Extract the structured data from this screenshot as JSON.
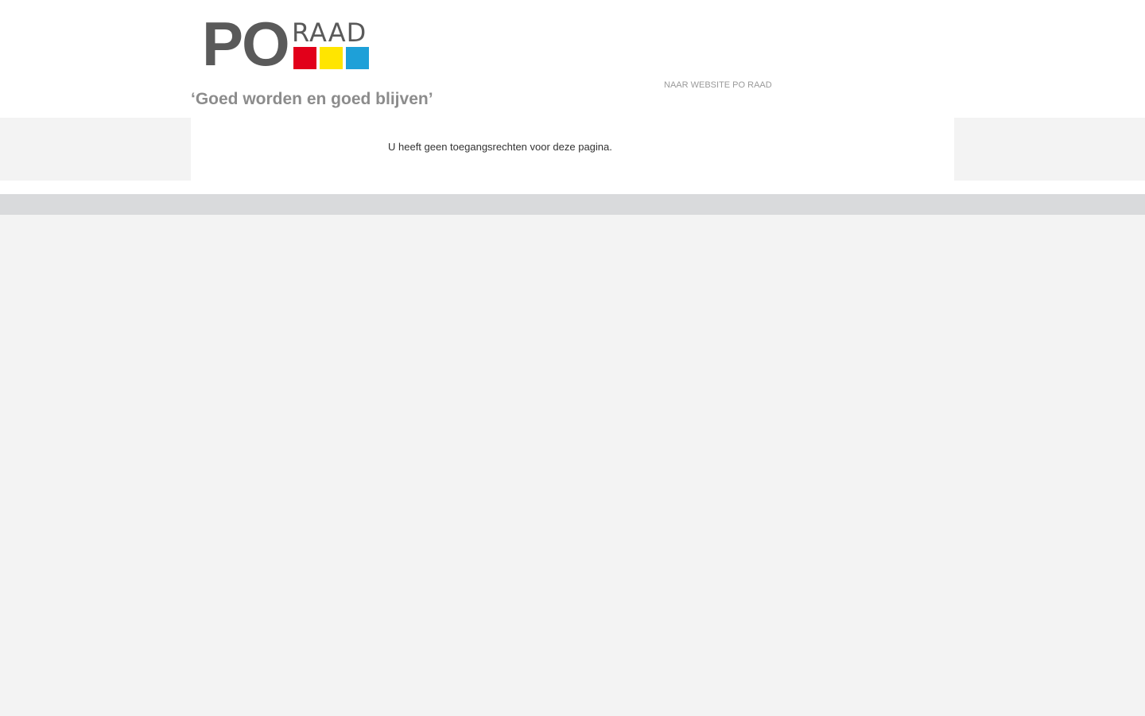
{
  "header": {
    "logo": {
      "po_text": "PO",
      "raad_text": "RAAD",
      "squares": [
        "#e2001a",
        "#ffe500",
        "#1ea0d8"
      ]
    },
    "tagline": "‘Goed worden en goed blijven’",
    "site_link": "NAAR WEBSITE PO RAAD"
  },
  "main": {
    "message": "U heeft geen toegangsrechten voor deze pagina."
  },
  "colors": {
    "background": "#f3f3f3",
    "footer_bar": "#d9dadc",
    "logo_gray": "#5a5a5a"
  }
}
